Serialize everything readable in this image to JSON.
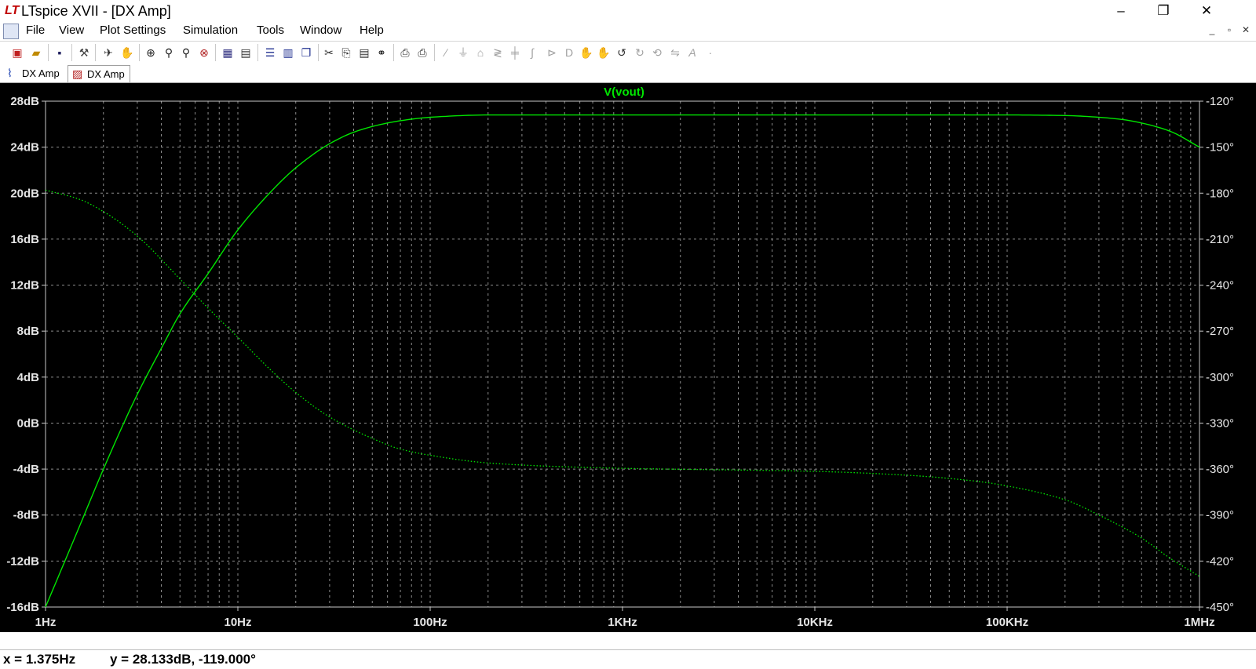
{
  "window": {
    "title": "LTspice XVII - [DX Amp]",
    "logo": "LT",
    "controls": {
      "minimize": "–",
      "maximize": "❐",
      "close": "✕"
    }
  },
  "menubar": {
    "items": [
      "File",
      "View",
      "Plot Settings",
      "Simulation",
      "Tools",
      "Window",
      "Help"
    ],
    "mdi_controls": {
      "minimize": "_",
      "restore": "▫",
      "close": "✕"
    }
  },
  "toolbar": {
    "icons": [
      "new-schematic-icon",
      "open-icon",
      "save-icon",
      "control-panel-icon",
      "run-icon",
      "halt-icon",
      "zoom-area-icon",
      "zoom-in-icon",
      "zoom-out-icon",
      "zoom-cancel-icon",
      "autorange-icon",
      "pick-traces-icon",
      "tile-horizontal-icon",
      "tile-vertical-icon",
      "cascade-icon",
      "cut-icon",
      "copy-icon",
      "paste-icon",
      "find-icon",
      "print-setup-icon",
      "print-icon",
      "wire-icon",
      "ground-icon",
      "label-icon",
      "resistor-icon",
      "capacitor-icon",
      "inductor-icon",
      "diode-icon",
      "component-icon",
      "move-icon",
      "drag-icon",
      "undo-icon",
      "redo-icon",
      "rotate-icon",
      "mirror-icon",
      "text-icon",
      "spice-directive-icon"
    ]
  },
  "tabs": [
    {
      "label": "DX Amp",
      "icon": "schematic-icon",
      "color": "#1a3fb0"
    },
    {
      "label": "DX Amp",
      "icon": "waveform-icon",
      "color": "#b01a1a",
      "active": true
    }
  ],
  "chart_data": {
    "type": "line",
    "title": "V(vout)",
    "x_scale": "log",
    "xlim": [
      1,
      1000000
    ],
    "x_ticks": [
      {
        "value": 1,
        "label": "1Hz"
      },
      {
        "value": 10,
        "label": "10Hz"
      },
      {
        "value": 100,
        "label": "100Hz"
      },
      {
        "value": 1000,
        "label": "1KHz"
      },
      {
        "value": 10000,
        "label": "10KHz"
      },
      {
        "value": 100000,
        "label": "100KHz"
      },
      {
        "value": 1000000,
        "label": "1MHz"
      }
    ],
    "ylim_left": [
      -16,
      28
    ],
    "y_ticks_left": [
      {
        "value": 28,
        "label": "28dB"
      },
      {
        "value": 24,
        "label": "24dB"
      },
      {
        "value": 20,
        "label": "20dB"
      },
      {
        "value": 16,
        "label": "16dB"
      },
      {
        "value": 12,
        "label": "12dB"
      },
      {
        "value": 8,
        "label": "8dB"
      },
      {
        "value": 4,
        "label": "4dB"
      },
      {
        "value": 0,
        "label": "0dB"
      },
      {
        "value": -4,
        "label": "-4dB"
      },
      {
        "value": -8,
        "label": "-8dB"
      },
      {
        "value": -12,
        "label": "-12dB"
      },
      {
        "value": -16,
        "label": "-16dB"
      }
    ],
    "ylim_right": [
      -450,
      -120
    ],
    "y_ticks_right": [
      {
        "value": -120,
        "label": "-120°"
      },
      {
        "value": -150,
        "label": "-150°"
      },
      {
        "value": -180,
        "label": "-180°"
      },
      {
        "value": -210,
        "label": "-210°"
      },
      {
        "value": -240,
        "label": "-240°"
      },
      {
        "value": -270,
        "label": "-270°"
      },
      {
        "value": -300,
        "label": "-300°"
      },
      {
        "value": -330,
        "label": "-330°"
      },
      {
        "value": -360,
        "label": "-360°"
      },
      {
        "value": -390,
        "label": "-390°"
      },
      {
        "value": -420,
        "label": "-420°"
      },
      {
        "value": -450,
        "label": "-450°"
      }
    ],
    "grid": true,
    "series": [
      {
        "style": "solid",
        "axis": "left",
        "color": "#00e600",
        "points": [
          [
            1,
            -16
          ],
          [
            1.5,
            -9
          ],
          [
            2,
            -4
          ],
          [
            3,
            2.5
          ],
          [
            4,
            6.5
          ],
          [
            5,
            9.5
          ],
          [
            7,
            13
          ],
          [
            10,
            16.8
          ],
          [
            15,
            20.2
          ],
          [
            20,
            22.2
          ],
          [
            30,
            24.3
          ],
          [
            40,
            25.3
          ],
          [
            50,
            25.8
          ],
          [
            70,
            26.3
          ],
          [
            100,
            26.6
          ],
          [
            200,
            26.8
          ],
          [
            500,
            26.8
          ],
          [
            1000,
            26.8
          ],
          [
            10000,
            26.8
          ],
          [
            100000,
            26.8
          ],
          [
            200000,
            26.75
          ],
          [
            300000,
            26.6
          ],
          [
            400000,
            26.4
          ],
          [
            500000,
            26.1
          ],
          [
            700000,
            25.4
          ],
          [
            1000000,
            24
          ]
        ]
      },
      {
        "style": "dotted",
        "axis": "right",
        "color": "#00e600",
        "points": [
          [
            1,
            -178
          ],
          [
            1.5,
            -184
          ],
          [
            2,
            -192
          ],
          [
            3,
            -208
          ],
          [
            5,
            -236
          ],
          [
            7,
            -255
          ],
          [
            10,
            -274
          ],
          [
            15,
            -296
          ],
          [
            20,
            -310
          ],
          [
            30,
            -326
          ],
          [
            50,
            -340
          ],
          [
            70,
            -347
          ],
          [
            100,
            -351
          ],
          [
            200,
            -356
          ],
          [
            500,
            -358.5
          ],
          [
            1000,
            -359.5
          ],
          [
            10000,
            -361.5
          ],
          [
            30000,
            -364
          ],
          [
            70000,
            -368
          ],
          [
            100000,
            -371
          ],
          [
            200000,
            -380
          ],
          [
            300000,
            -390
          ],
          [
            500000,
            -405
          ],
          [
            700000,
            -418
          ],
          [
            1000000,
            -430
          ]
        ]
      }
    ]
  },
  "status": {
    "x_readout": "x = 1.375Hz",
    "y_readout": "y = 28.133dB, -119.000°"
  }
}
